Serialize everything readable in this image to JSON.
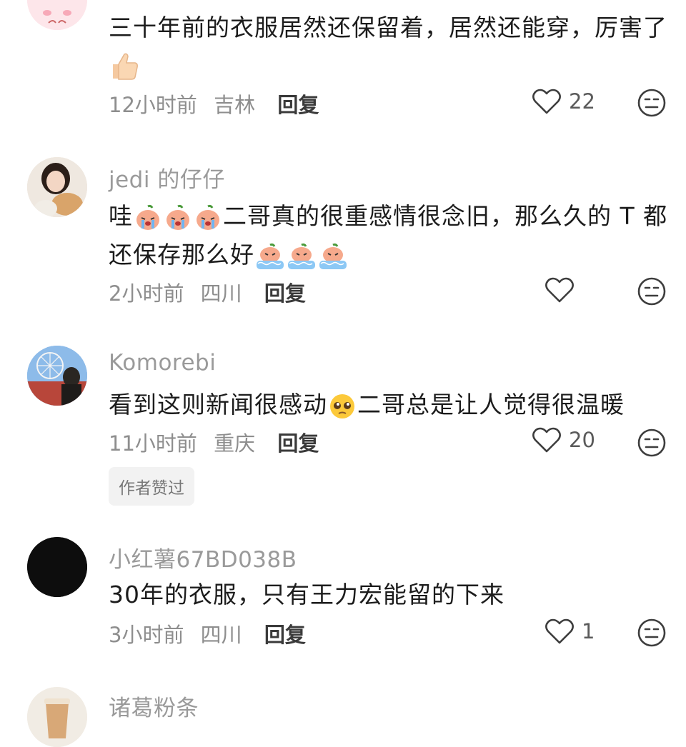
{
  "comments": [
    {
      "username": "",
      "text_line1": "三十年前的衣服居然还保留着，居然还能穿，厉害了",
      "time": "12小时前",
      "location": "吉林",
      "reply_label": "回复",
      "likes": "22",
      "avatar_icon": "cartoon-pig-avatar",
      "trailing_emoji": "thumbs-up-emoji"
    },
    {
      "username": "jedi 的仔仔",
      "text_line1_prefix": "哇",
      "text_line1_suffix": "二哥真的很重感情很念旧，那么久的 T 都",
      "text_line2_prefix": "还保存那么好",
      "time": "2小时前",
      "location": "四川",
      "reply_label": "回复",
      "likes": "",
      "avatar_icon": "girl-with-dog-avatar",
      "emoji_1": "crying-peach-emoji",
      "emoji_2": "tear-pool-peach-emoji"
    },
    {
      "username": "Komorebi",
      "text_line1_prefix": "看到这则新闻很感动",
      "text_line1_suffix": "二哥总是让人觉得很温暖",
      "time": "11小时前",
      "location": "重庆",
      "reply_label": "回复",
      "likes": "20",
      "author_badge": "作者赞过",
      "avatar_icon": "ferris-wheel-photo-avatar",
      "emoji": "pleading-face-emoji"
    },
    {
      "username": "小红薯67BD038B",
      "text_line1": "30年的衣服，只有王力宏能留的下来",
      "time": "3小时前",
      "location": "四川",
      "reply_label": "回复",
      "likes": "1",
      "avatar_icon": "black-avatar"
    },
    {
      "username": "诸葛粉条",
      "avatar_icon": "coffee-cup-avatar"
    }
  ],
  "colors": {
    "username": "#9a9a9a",
    "text": "#1c1c1c",
    "meta": "#8e8e8e",
    "icon_stroke": "#3d3d3d",
    "badge_bg": "#f2f2f2"
  }
}
